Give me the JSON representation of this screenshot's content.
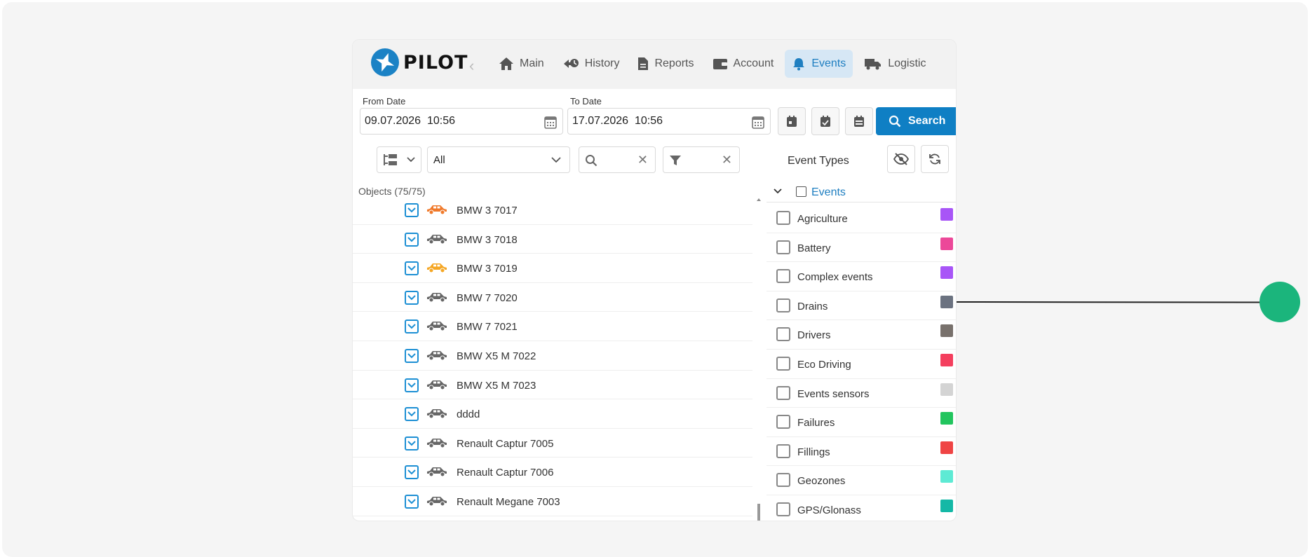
{
  "logo": {
    "text": "PILOT"
  },
  "nav": {
    "items": [
      {
        "label": "Main",
        "icon": "home-icon"
      },
      {
        "label": "History",
        "icon": "history-icon"
      },
      {
        "label": "Reports",
        "icon": "report-icon"
      },
      {
        "label": "Account",
        "icon": "wallet-icon"
      },
      {
        "label": "Events",
        "icon": "bell-icon",
        "active": true
      },
      {
        "label": "Logistic",
        "icon": "truck-icon"
      }
    ]
  },
  "dates": {
    "from_label": "From Date",
    "from_value": "09.07.2026  10:56",
    "to_label": "To Date",
    "to_value": "17.07.2026  10:56"
  },
  "search_button": "Search",
  "filters": {
    "group_select": "All"
  },
  "event_types_label": "Event Types",
  "objects": {
    "header": "Objects (75/75)",
    "items": [
      {
        "name": "BMW 3 7017",
        "color": "#f07a2b"
      },
      {
        "name": "BMW 3 7018",
        "color": "#666666"
      },
      {
        "name": "BMW 3 7019",
        "color": "#f5a623"
      },
      {
        "name": "BMW 7 7020",
        "color": "#666666"
      },
      {
        "name": "BMW 7 7021",
        "color": "#666666"
      },
      {
        "name": "BMW X5 M 7022",
        "color": "#666666"
      },
      {
        "name": "BMW X5 M 7023",
        "color": "#666666"
      },
      {
        "name": "dddd",
        "color": "#666666"
      },
      {
        "name": "Renault Captur 7005",
        "color": "#666666"
      },
      {
        "name": "Renault Captur 7006",
        "color": "#666666"
      },
      {
        "name": "Renault Megane 7003",
        "color": "#666666"
      }
    ]
  },
  "events": {
    "header": "Events",
    "items": [
      {
        "name": "Agriculture",
        "color": "#a855f7"
      },
      {
        "name": "Battery",
        "color": "#ec4899"
      },
      {
        "name": "Complex events",
        "color": "#a855f7"
      },
      {
        "name": "Drains",
        "color": "#6b7280"
      },
      {
        "name": "Drivers",
        "color": "#78716c"
      },
      {
        "name": "Eco Driving",
        "color": "#f43f5e"
      },
      {
        "name": "Events sensors",
        "color": "#d4d4d4"
      },
      {
        "name": "Failures",
        "color": "#22c55e"
      },
      {
        "name": "Fillings",
        "color": "#ef4444"
      },
      {
        "name": "Geozones",
        "color": "#5eead4"
      },
      {
        "name": "GPS/Glonass",
        "color": "#14b8a6"
      }
    ]
  }
}
